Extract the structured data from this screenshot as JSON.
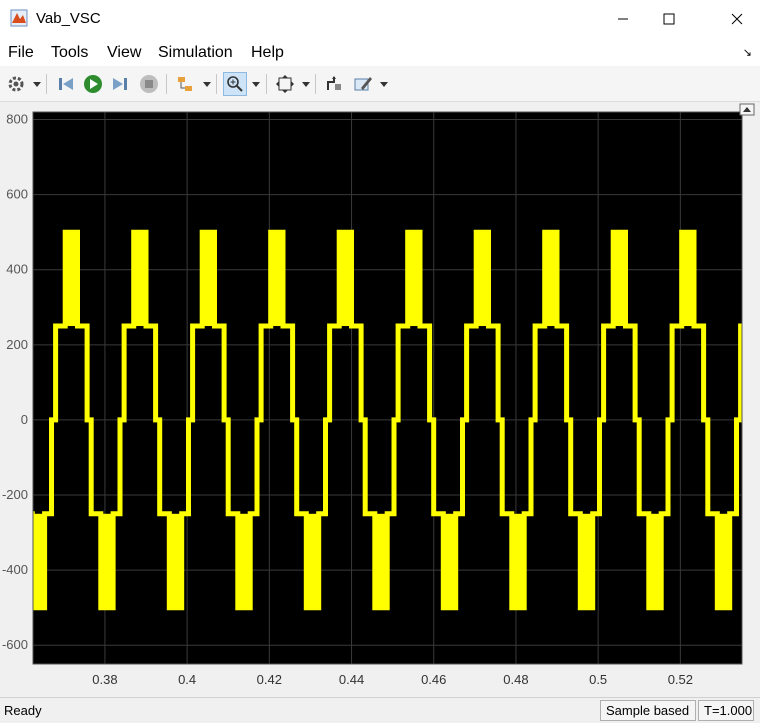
{
  "window": {
    "title": "Vab_VSC"
  },
  "menu": {
    "items": [
      "File",
      "Tools",
      "View",
      "Simulation",
      "Help"
    ]
  },
  "toolbar": {
    "buttons": [
      "settings-icon",
      "step-back-icon",
      "run-icon",
      "step-forward-icon",
      "stop-icon",
      "highlight-icon",
      "zoom-in-icon",
      "fit-to-view-icon",
      "cursor-measure-icon",
      "style-icon"
    ]
  },
  "status": {
    "ready": "Ready",
    "mode": "Sample based",
    "time": "T=1.000"
  },
  "colors": {
    "plot_bg": "#000000",
    "grid": "#3a3a3a",
    "signal": "#ffff00",
    "tick_text": "#c8c8c8"
  },
  "chart_data": {
    "type": "line",
    "xlim": [
      0.3625,
      0.535
    ],
    "ylim": [
      -650,
      820
    ],
    "xticks": [
      0.38,
      0.4,
      0.42,
      0.44,
      0.46,
      0.48,
      0.5,
      0.52
    ],
    "xtick_labels": [
      "0.38",
      "0.4",
      "0.42",
      "0.44",
      "0.46",
      "0.48",
      "0.5",
      "0.52"
    ],
    "yticks": [
      -600,
      -400,
      -200,
      0,
      200,
      400,
      600,
      800
    ],
    "ytick_labels": [
      "-600",
      "-400",
      "-200",
      "0",
      "200",
      "400",
      "600",
      "800"
    ],
    "grid": true,
    "series": [
      {
        "color": "#ffff00",
        "period": 0.0166667,
        "phase_start": 0.367,
        "levels": [
          0,
          250,
          500,
          250,
          0,
          -250,
          -500,
          -250
        ],
        "level_fraction": [
          0.06,
          0.14,
          0.18,
          0.14,
          0.06,
          0.14,
          0.18,
          0.1
        ]
      }
    ]
  }
}
